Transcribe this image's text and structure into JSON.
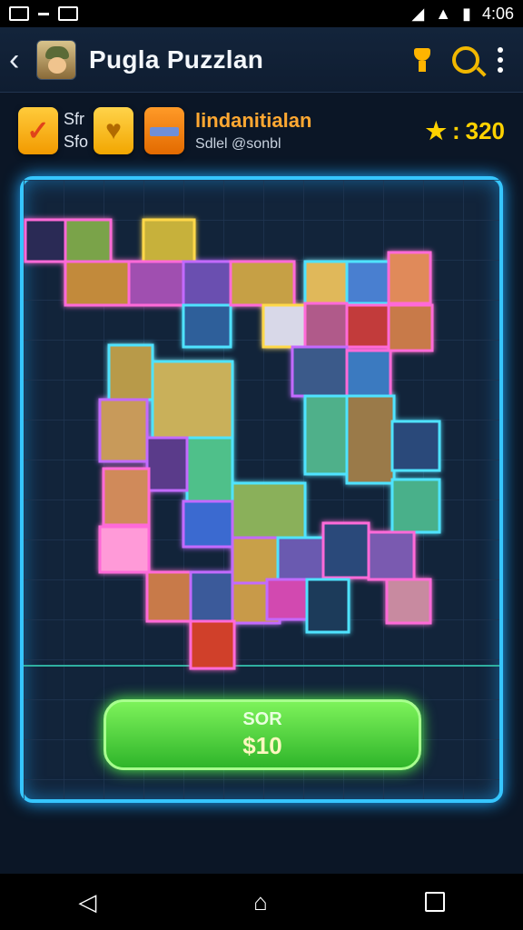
{
  "status": {
    "time": "4:06"
  },
  "appbar": {
    "title": "Pugla Puzzlan"
  },
  "info": {
    "mini_line1": "Sfr",
    "mini_line2": "Sfo",
    "title": "lindanitialan",
    "subtitle": "Sdlel @sonbl",
    "score": "320"
  },
  "button": {
    "line1": "SOR",
    "line2": "$10"
  },
  "colors": {
    "board_glow": "#36c6ff",
    "accent_yellow": "#ffd200",
    "button_green": "#2fb52a",
    "piece_pink": "#ff6bd8",
    "piece_cyan": "#4fe3ff"
  },
  "icons": {
    "back": "chevron-left-icon",
    "trophy": "trophy-icon",
    "search": "search-icon",
    "menu": "more-vertical-icon"
  }
}
